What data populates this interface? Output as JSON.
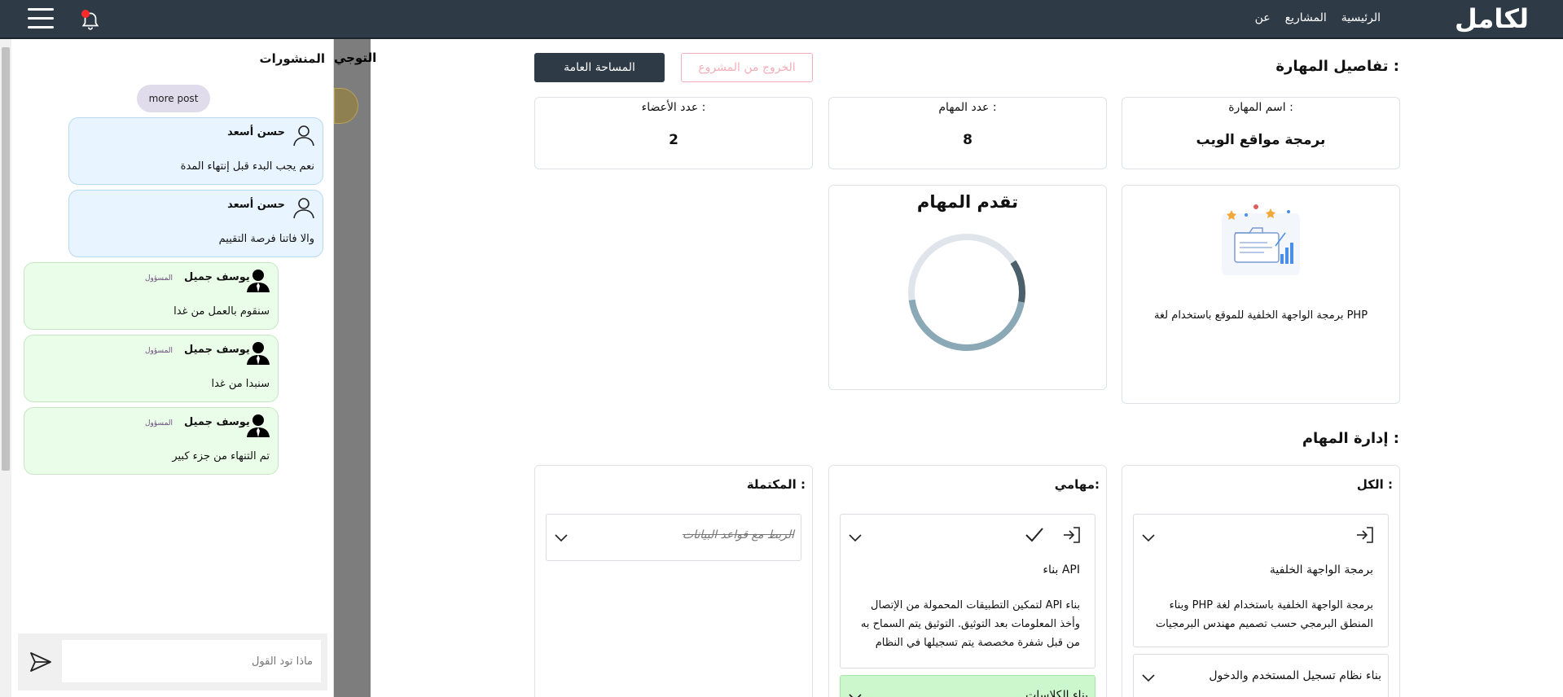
{
  "navbar": {
    "logo": "لكامل",
    "links": [
      "الرئيسية",
      "المشاريع",
      "عن"
    ]
  },
  "overlay": {
    "text": "التوجي"
  },
  "chat": {
    "title": "المنشورات",
    "more_label": "more post",
    "messages": [
      {
        "name": "حسن أسعد",
        "role": "",
        "text": "نعم يجب البدء قبل إنتهاء المدة",
        "kind": "member"
      },
      {
        "name": "حسن أسعد",
        "role": "",
        "text": "والا فاتنا فرصة التقييم",
        "kind": "member"
      },
      {
        "name": "يوسف جميل",
        "role": "المسؤول",
        "text": "سنقوم بالعمل من غدا",
        "kind": "admin"
      },
      {
        "name": "يوسف جميل",
        "role": "المسؤول",
        "text": "سنبدا من غدا",
        "kind": "admin"
      },
      {
        "name": "يوسف جميل",
        "role": "المسؤول",
        "text": "تم التنهاء من جزء كبير",
        "kind": "admin"
      }
    ],
    "input_placeholder": "ماذا تود القول"
  },
  "skill": {
    "section_title": "تفاصيل المهارة :",
    "public_button": "المساحة العامة",
    "exit_button": "الخروج من المشروع",
    "stats": {
      "skill_name_label": "اسم المهارة :",
      "skill_name_value": "برمجة مواقع الويب",
      "tasks_count_label": "عدد المهام :",
      "tasks_count_value": "8",
      "members_count_label": "عدد الأعضاء :",
      "members_count_value": "2"
    },
    "description": "برمجة الواجهة الخلفية للموقع باستخدام لغة PHP",
    "progress_title": "تقدم المهام",
    "progress_fraction": 0.12
  },
  "tasks": {
    "section_title": "إدارة المهام :",
    "columns": {
      "all": "الكل :",
      "mine": "مهامي:",
      "done": "المكتملة :"
    },
    "all_tasks": [
      {
        "title": "برمجة الواجهة الخلفية",
        "desc": "برمجة الواجهة الخلفية باستخدام لغة PHP وبناء المنطق البرمجي حسب تصميم مهندس البرمجيات"
      },
      {
        "title": "بناء نظام تسجيل المستخدم والدخول"
      }
    ],
    "my_tasks": [
      {
        "title": "بناء API",
        "desc": "بناء API لتمكين التطبيقات المحمولة من الإتصال وأخذ المعلومات بعد التوثيق. التوثيق يتم السماح به من قبل شفرة مخصصة يتم تسجيلها في النظام"
      },
      {
        "title": "بناء الكلاسات"
      }
    ],
    "done_tasks": [
      {
        "title": "الربط مع قواعد البيانات"
      }
    ]
  },
  "colors": {
    "navbar": "#2e3a46",
    "member_bubble": "#e8f4ff",
    "admin_bubble": "#e9fde8",
    "exit_button": "#f5aeb9",
    "done_task": "#ccf7cc",
    "progress_track": "#dfe5ea",
    "progress_arc_light": "#8aa8b5",
    "progress_arc_dark": "#4c606c"
  }
}
